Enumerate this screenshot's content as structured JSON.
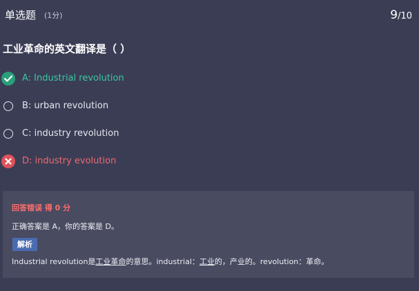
{
  "header": {
    "question_type": "单选题",
    "score": "(1分)",
    "progress_current": "9",
    "progress_total": "/10"
  },
  "question": {
    "title": "工业革命的英文翻译是（ ）"
  },
  "options": [
    {
      "label": "A: Industrial revolution",
      "state": "correct",
      "icon": "check-circle-icon"
    },
    {
      "label": "B: urban revolution",
      "state": "unselected",
      "icon": "radio-icon"
    },
    {
      "label": "C: industry revolution",
      "state": "unselected",
      "icon": "radio-icon"
    },
    {
      "label": "D: industry evolution",
      "state": "wrong",
      "icon": "x-circle-icon"
    }
  ],
  "analysis": {
    "result": "回答错误 得 0 分",
    "answer_text": "正确答案是 A，你的答案是 D。",
    "tag_label": "解析",
    "explanation": {
      "part1": "Industrial revolution是",
      "part2": "工业革命",
      "part3": "的意思。industrial：",
      "part4": "工业",
      "part5": "的，产业的。revolution：革命。"
    }
  },
  "colors": {
    "background": "#3b3d55",
    "panel": "#494b61",
    "correct": "#2aa07a",
    "correct_text": "#3bc8a0",
    "wrong": "#e0525a",
    "wrong_text": "#ef6a6e",
    "tag": "#4a6bb0"
  }
}
